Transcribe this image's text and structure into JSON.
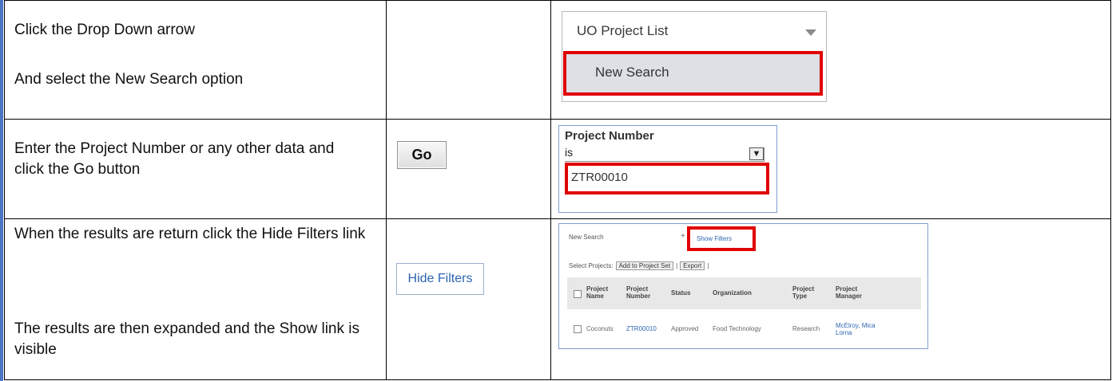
{
  "rows": [
    {
      "instructions": [
        "Click the Drop Down arrow",
        "And select the New Search option"
      ]
    },
    {
      "instructions": [
        "Enter the Project Number or any other data and click the Go button"
      ],
      "button_label": "Go"
    },
    {
      "instructions": [
        "When the results are return click the Hide Filters link",
        "The results are then expanded and the Show link is visible"
      ],
      "button_label": "Hide Filters"
    }
  ],
  "dropdown": {
    "title": "UO Project List",
    "selected_option": "New Search",
    "arrow_icon": "triangle-down-icon"
  },
  "search": {
    "label": "Project Number",
    "operator": "is",
    "value": "ZTR00010",
    "select_icon": "chevron-down-icon"
  },
  "results": {
    "new_search": "New Search",
    "show_filters": "Show Filters",
    "select_projects": "Select Projects:",
    "add_button": "Add to Project Set",
    "export_button": "Export",
    "columns": [
      "Project Name",
      "Project Number",
      "Status",
      "Organization",
      "Project Type",
      "Project Manager"
    ],
    "row": [
      "Coconuts",
      "ZTR00010",
      "Approved",
      "Food Technology",
      "Research",
      "McElroy, Mica Lorna"
    ]
  },
  "colors": {
    "highlight": "#e00000",
    "link": "#2d66b1",
    "left_rule": "#4a74c4"
  }
}
